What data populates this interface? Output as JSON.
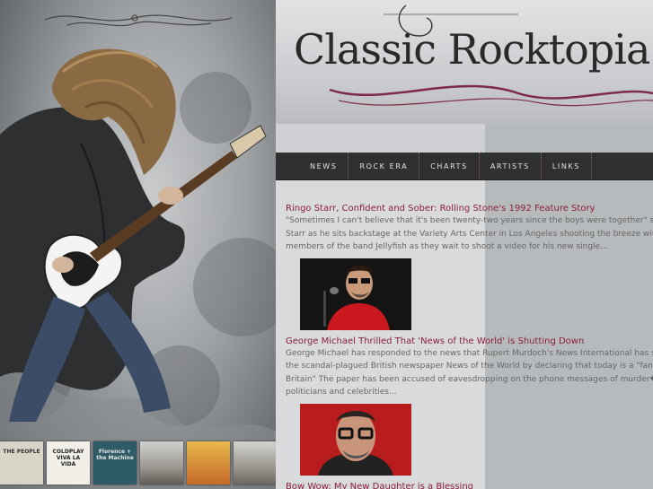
{
  "site": {
    "title": "Classic Rocktopia",
    "accent": "#8a1f3c",
    "nav_bg": "#2f3032"
  },
  "nav": {
    "items": [
      {
        "label": "NEWS"
      },
      {
        "label": "ROCK ERA"
      },
      {
        "label": "CHARTS"
      },
      {
        "label": "ARTISTS"
      },
      {
        "label": "LINKS"
      }
    ]
  },
  "albums": [
    {
      "label": "THE PEOPLE",
      "color": "#d8d4c8"
    },
    {
      "label": "COLDPLAY VIVA LA VIDA",
      "color": "#f1efe8"
    },
    {
      "label": "Florence + the Machine",
      "color": "#2f5b66"
    },
    {
      "label": "",
      "color": "#6f6a64"
    },
    {
      "label": "",
      "color": "#d9a53b"
    },
    {
      "label": "",
      "color": "#7a7670"
    }
  ],
  "stories": [
    {
      "headline": "Ringo Starr, Confident and Sober: Rolling Stone's 1992 Feature Story",
      "lines": [
        "\"Sometimes I can't believe that it's been twenty-two years since the boys were together\" says Ringo",
        "Starr as he sits backstage at the Variety Arts Center in Los Angeles shooting the breeze with two",
        "members of the band Jellyfish as they wait to shoot a video for his new single..."
      ],
      "image": "ringo-starr-photo"
    },
    {
      "headline": "George Michael Thrilled That 'News of the World' is Shutting Down",
      "lines": [
        "George Michael has responded to the news that Rupert Murdoch's News International has shut",
        "the scandal-plagued British newspaper News of the World by declaring that today is a \"fantastic",
        "Britain\" The paper has been accused of eavesdropping on the phone messages of murder� victims,",
        "politicians and celebrities..."
      ],
      "image": "george-michael-photo"
    },
    {
      "headline": "Bow Wow: My New Daughter is a Blessing",
      "lines": [],
      "image": ""
    }
  ]
}
